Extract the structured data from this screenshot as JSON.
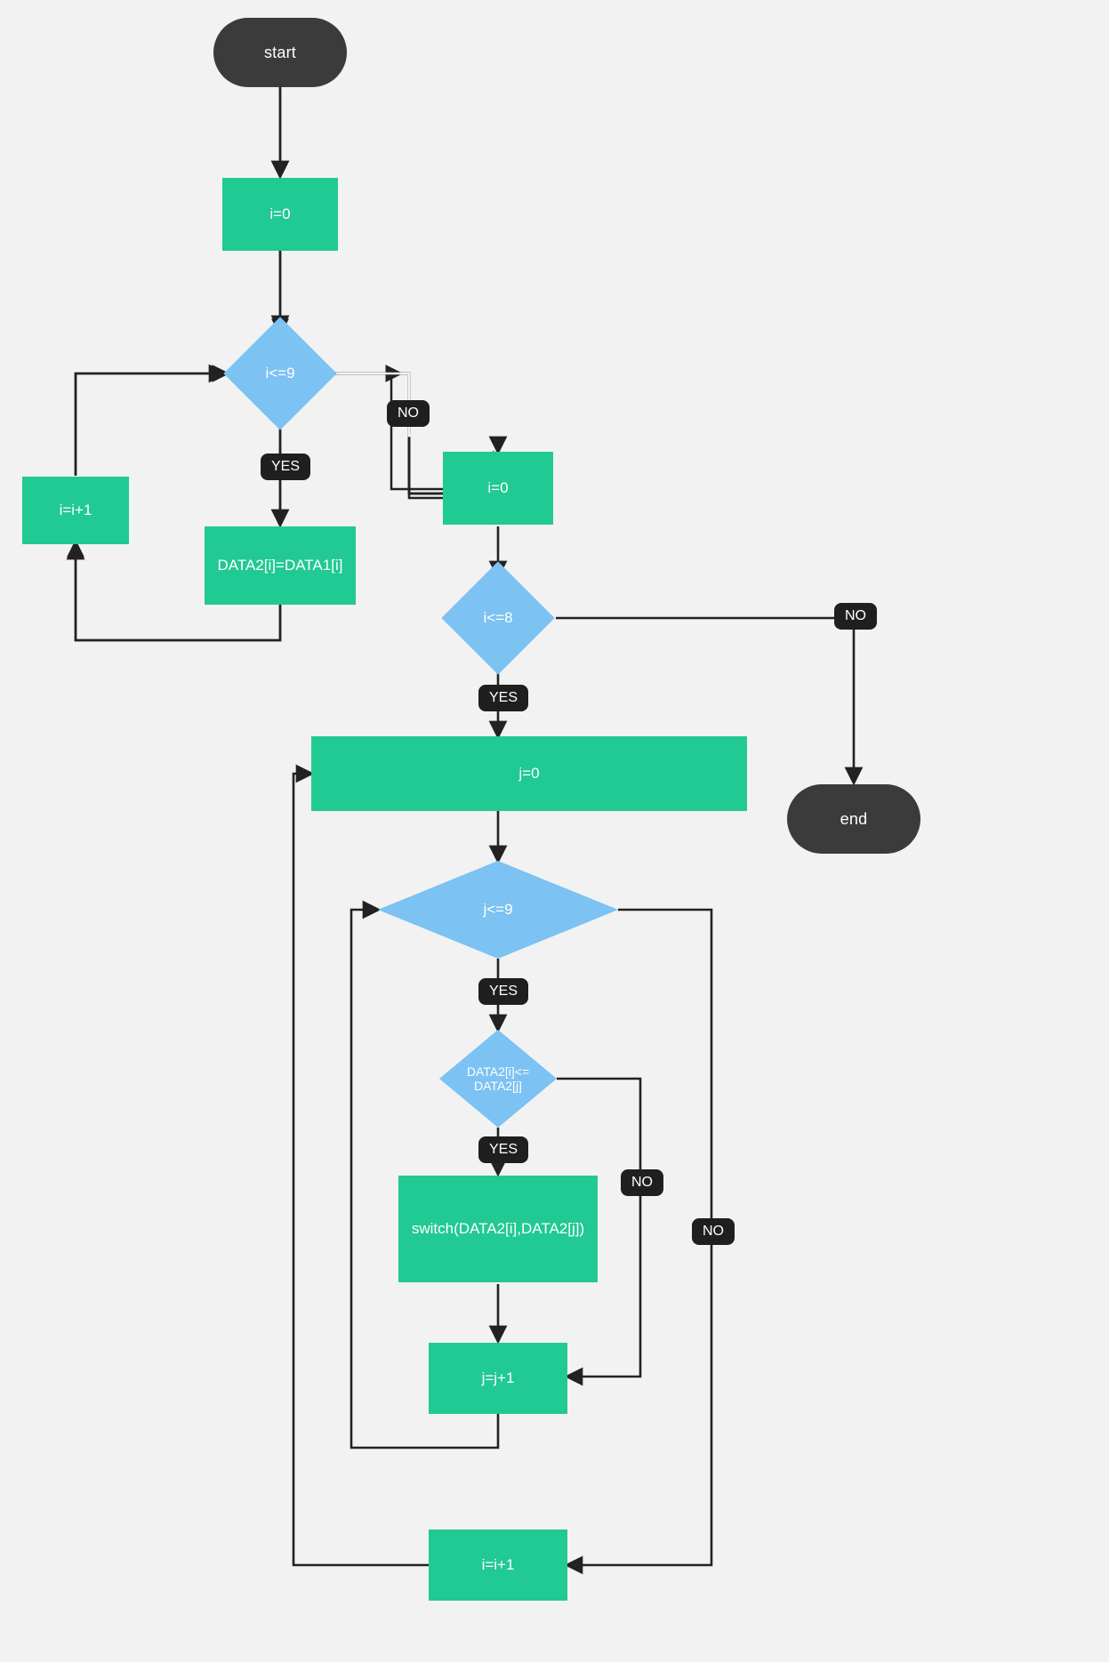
{
  "nodes": {
    "start": "start",
    "n_i0_a": "i=0",
    "d_ile9": "i<=9",
    "n_copy": "DATA2[i]=DATA1[i]",
    "n_iinc_a": "i=i+1",
    "n_i0_b": "i=0",
    "d_ile8": "i<=8",
    "n_j0": "j=0",
    "d_jle9": "j<=9",
    "d_cmp": "DATA2[i]<=\nDATA2[j]",
    "n_switch": "switch(DATA2[i],DATA2[j])",
    "n_jinc": "j=j+1",
    "n_iinc_b": "i=i+1",
    "end": "end"
  },
  "labels": {
    "yes": "YES",
    "no": "NO"
  },
  "colors": {
    "process": "#21c993",
    "decision": "#7cc2f2",
    "terminator": "#3b3b3b",
    "badge": "#1f1f1f",
    "bg": "#f2f2f2",
    "edge": "#222222"
  },
  "chart_data": {
    "type": "flowchart",
    "nodes": [
      {
        "id": "start",
        "kind": "terminator",
        "label": "start"
      },
      {
        "id": "i0a",
        "kind": "process",
        "label": "i=0"
      },
      {
        "id": "dile9",
        "kind": "decision",
        "label": "i<=9"
      },
      {
        "id": "copy",
        "kind": "process",
        "label": "DATA2[i]=DATA1[i]"
      },
      {
        "id": "iinca",
        "kind": "process",
        "label": "i=i+1"
      },
      {
        "id": "i0b",
        "kind": "process",
        "label": "i=0"
      },
      {
        "id": "dile8",
        "kind": "decision",
        "label": "i<=8"
      },
      {
        "id": "j0",
        "kind": "process",
        "label": "j=0"
      },
      {
        "id": "djle9",
        "kind": "decision",
        "label": "j<=9"
      },
      {
        "id": "dcmp",
        "kind": "decision",
        "label": "DATA2[i]<=DATA2[j]"
      },
      {
        "id": "switch",
        "kind": "process",
        "label": "switch(DATA2[i],DATA2[j])"
      },
      {
        "id": "jinc",
        "kind": "process",
        "label": "j=j+1"
      },
      {
        "id": "iincb",
        "kind": "process",
        "label": "i=i+1"
      },
      {
        "id": "end",
        "kind": "terminator",
        "label": "end"
      }
    ],
    "edges": [
      {
        "from": "start",
        "to": "i0a"
      },
      {
        "from": "i0a",
        "to": "dile9"
      },
      {
        "from": "dile9",
        "to": "copy",
        "label": "YES"
      },
      {
        "from": "copy",
        "to": "iinca"
      },
      {
        "from": "iinca",
        "to": "dile9"
      },
      {
        "from": "dile9",
        "to": "i0b",
        "label": "NO"
      },
      {
        "from": "i0b",
        "to": "dile8"
      },
      {
        "from": "dile8",
        "to": "j0",
        "label": "YES"
      },
      {
        "from": "dile8",
        "to": "end",
        "label": "NO"
      },
      {
        "from": "j0",
        "to": "djle9"
      },
      {
        "from": "djle9",
        "to": "dcmp",
        "label": "YES"
      },
      {
        "from": "dcmp",
        "to": "switch",
        "label": "YES"
      },
      {
        "from": "switch",
        "to": "jinc"
      },
      {
        "from": "dcmp",
        "to": "jinc",
        "label": "NO"
      },
      {
        "from": "jinc",
        "to": "djle9"
      },
      {
        "from": "djle9",
        "to": "iincb",
        "label": "NO"
      },
      {
        "from": "iincb",
        "to": "dile8"
      }
    ]
  }
}
